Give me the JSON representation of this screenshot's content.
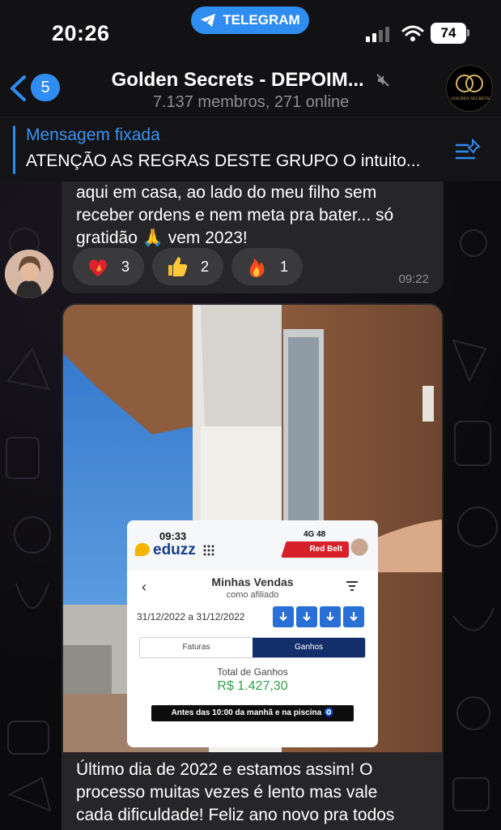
{
  "status_bar": {
    "time": "20:26",
    "telegram_pill": "TELEGRAM",
    "battery": "74"
  },
  "header": {
    "back_count": "5",
    "title": "Golden Secrets - DEPOIM...",
    "subtitle": "7.137 membros, 271 online",
    "avatar_text": "GOLDEN SECRETS"
  },
  "pinned": {
    "label": "Mensagem fixada",
    "text": "ATENÇÃO AS REGRAS DESTE GRUPO O intuito..."
  },
  "message1": {
    "text_lines": [
      "aqui em casa, ao lado do meu filho sem",
      "receber ordens e nem meta pra bater... só",
      "gratidão 🙏 vem 2023!"
    ],
    "reactions": [
      {
        "icon": "heart-fire-icon",
        "count": "3"
      },
      {
        "icon": "thumbs-up-icon",
        "count": "2"
      },
      {
        "icon": "fire-icon",
        "count": "1"
      }
    ],
    "time": "09:22"
  },
  "message2": {
    "text_lines": [
      "Último dia de 2022 e estamos assim! O",
      "processo muitas vezes é lento mas vale",
      "cada dificuldade! Feliz ano novo pra todos"
    ],
    "card": {
      "time": "09:33",
      "logo": "eduzz",
      "network": "4G",
      "network_battery": "48",
      "badge": "Red Belt",
      "back": "‹",
      "title": "Minhas Vendas",
      "subtitle": "como afiliado",
      "date_range": "31/12/2022 a 31/12/2022",
      "tabs": [
        "Faturas",
        "Ganhos"
      ],
      "total_label": "Total de Ganhos",
      "total_value": "R$  1.427,30",
      "caption": "Antes das 10:00 da manhã e na piscina 🧿"
    }
  }
}
